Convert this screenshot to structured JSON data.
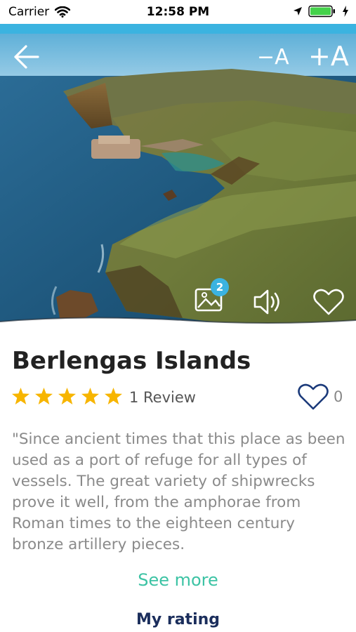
{
  "status_bar": {
    "carrier": "Carrier",
    "time": "12:58 PM"
  },
  "colors": {
    "accent_strip": "#3bb3e0",
    "star": "#f7b500",
    "heart_outline": "#1b3a7a",
    "see_more": "#3cc3a4",
    "my_rating": "#1b2e5c",
    "battery": "#44d24a"
  },
  "hero": {
    "icons": [
      "back-arrow-icon",
      "gallery-icon",
      "speaker-icon",
      "heart-icon"
    ],
    "font_decrease": "−A",
    "font_increase": "+A",
    "gallery_badge": "2"
  },
  "place": {
    "title": "Berlengas Islands",
    "rating": 5,
    "review_text": "1 Review",
    "favorites_count": "0",
    "description": "\"Since ancient times that this place as been used as a port of refuge for all types of vessels. The great variety of shipwrecks prove it well, from the amphorae from Roman times to the eighteen century bronze artillery pieces.",
    "see_more": "See more",
    "my_rating": "My rating"
  }
}
